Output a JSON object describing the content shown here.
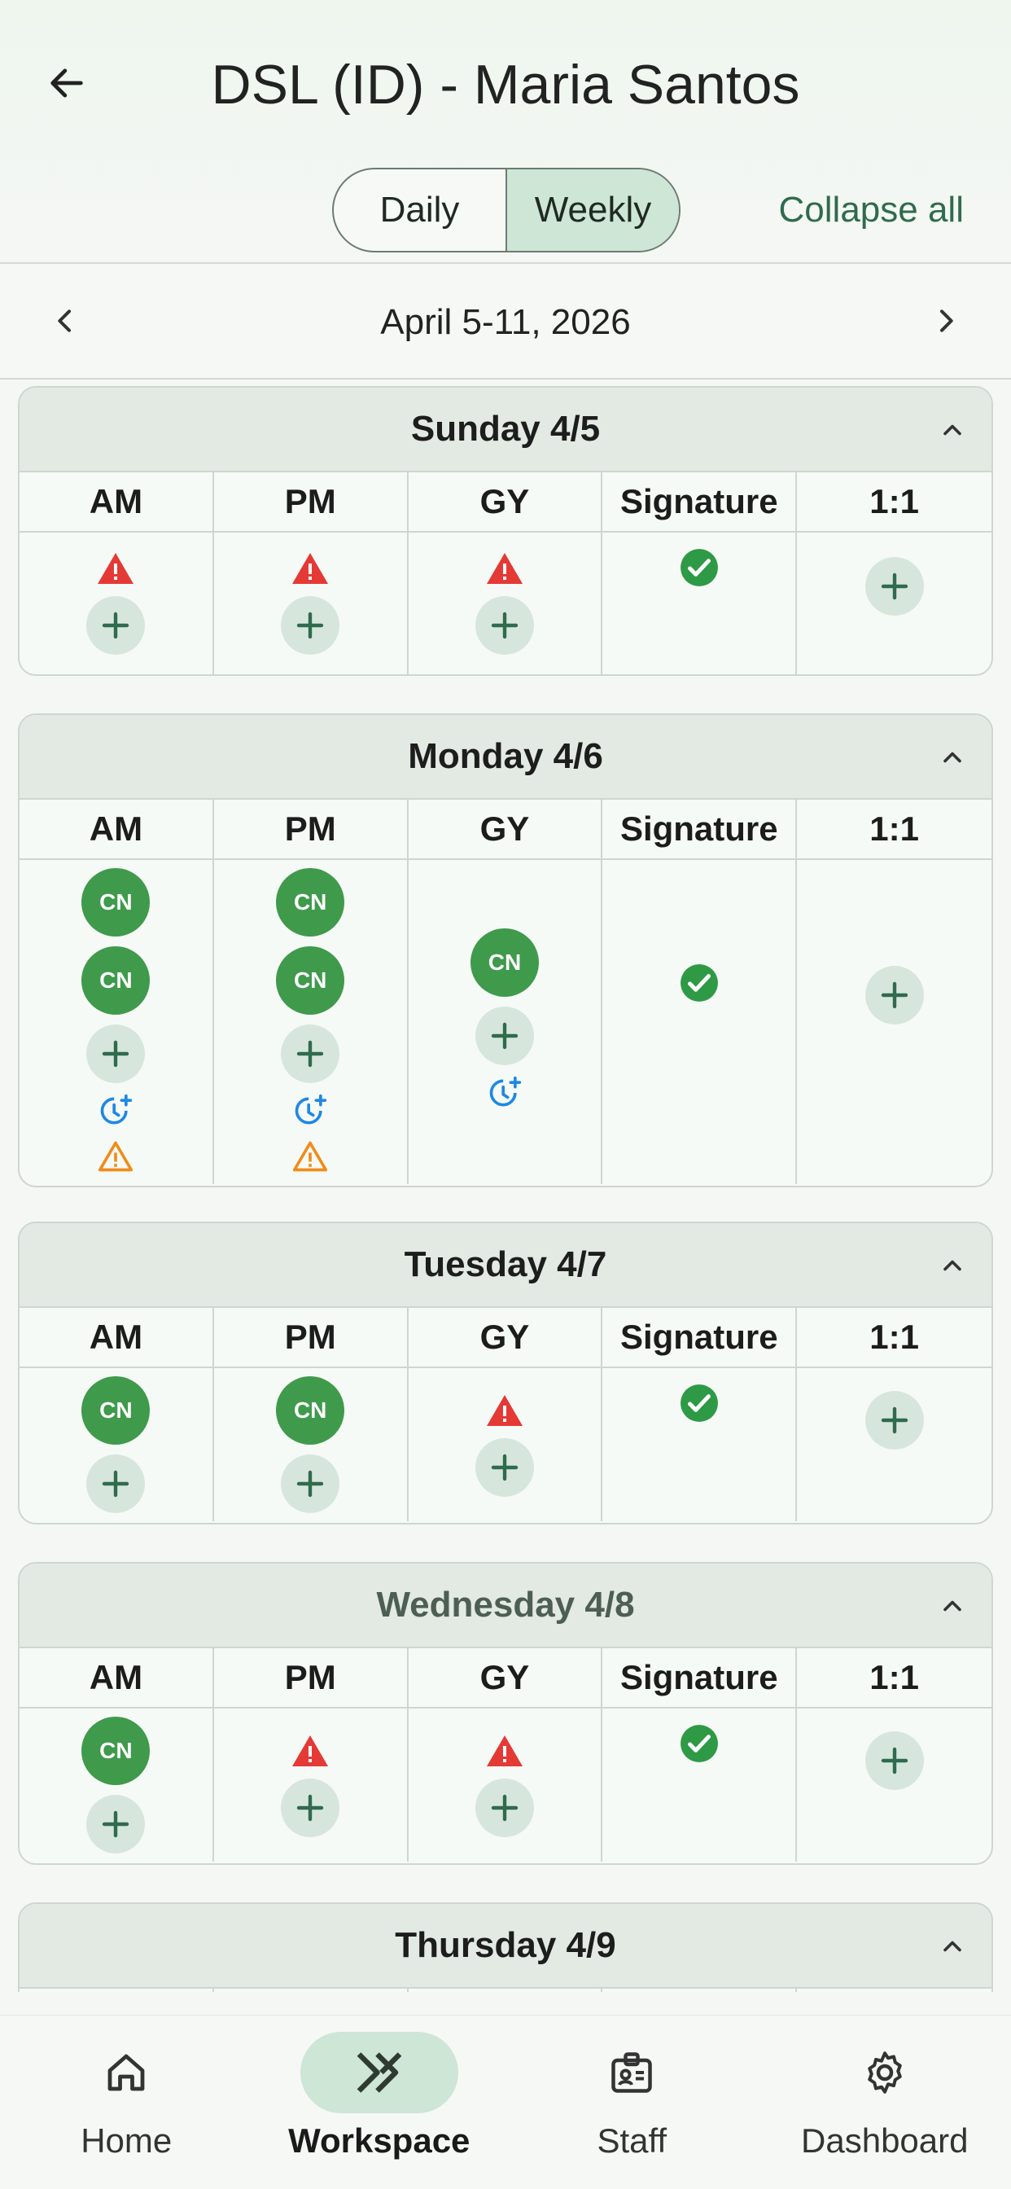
{
  "header": {
    "title": "DSL (ID) - Maria Santos",
    "view_toggle": {
      "daily": "Daily",
      "weekly": "Weekly",
      "selected": "Weekly"
    },
    "collapse_all": "Collapse all"
  },
  "week": {
    "range": "April 5-11, 2026"
  },
  "columns": [
    "AM",
    "PM",
    "GY",
    "Signature",
    "1:1"
  ],
  "days": [
    {
      "label": "Sunday 4/5"
    },
    {
      "label": "Monday 4/6"
    },
    {
      "label": "Tuesday 4/7"
    },
    {
      "label": "Wednesday 4/8"
    },
    {
      "label": "Thursday 4/9"
    }
  ],
  "badge": {
    "cn": "CN"
  },
  "colors": {
    "accent": "#2f6b4c",
    "cn_badge": "#3f9a4c",
    "alert_red": "#e53935",
    "warning_orange": "#f08c1a",
    "schedule_blue": "#1e88e5",
    "signed_green": "#2e9a45"
  },
  "bottom_nav": [
    {
      "label": "Home",
      "icon": "home-icon"
    },
    {
      "label": "Workspace",
      "icon": "workspace-icon",
      "active": true
    },
    {
      "label": "Staff",
      "icon": "badge-icon"
    },
    {
      "label": "Dashboard",
      "icon": "gear-icon"
    }
  ]
}
